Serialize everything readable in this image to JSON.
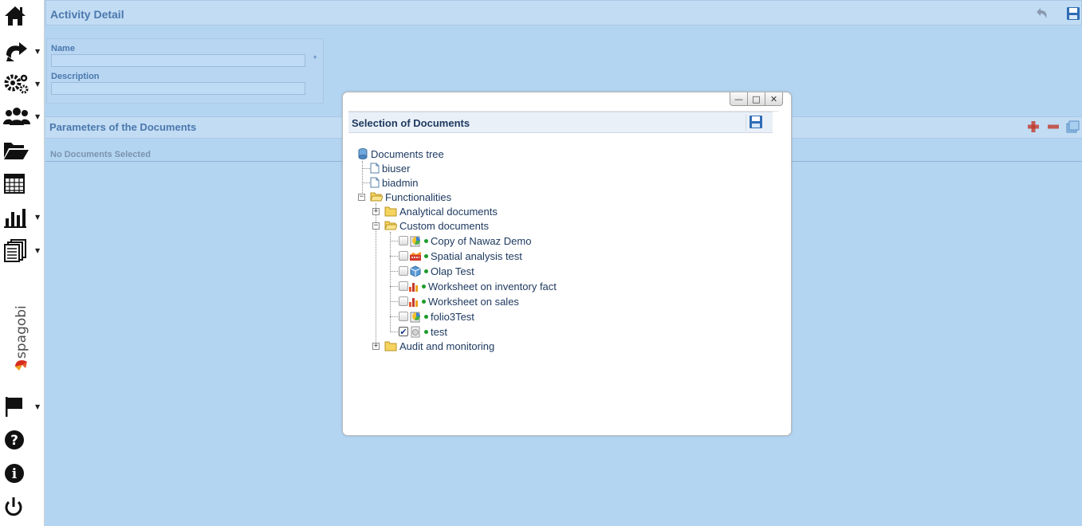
{
  "sidebar": {
    "logo_text": "spagobi",
    "items": [
      {
        "icon": "home-icon",
        "has_menu": false
      },
      {
        "icon": "roles-icon",
        "has_menu": true
      },
      {
        "icon": "gears-icon",
        "has_menu": true
      },
      {
        "icon": "users-icon",
        "has_menu": true
      },
      {
        "icon": "folder-icon",
        "has_menu": false
      },
      {
        "icon": "calendar-icon",
        "has_menu": false
      },
      {
        "icon": "bar-chart-icon",
        "has_menu": true
      },
      {
        "icon": "documents-icon",
        "has_menu": true
      },
      {
        "icon": "flag-icon",
        "has_menu": true
      },
      {
        "icon": "help-icon",
        "has_menu": false
      },
      {
        "icon": "info-icon",
        "has_menu": false
      },
      {
        "icon": "power-icon",
        "has_menu": false
      }
    ]
  },
  "header": {
    "title": "Activity Detail"
  },
  "form": {
    "name_label": "Name",
    "name_value": "",
    "required_mark": "*",
    "description_label": "Description",
    "description_value": ""
  },
  "parameters": {
    "title": "Parameters of the Documents",
    "empty_text": "No Documents Selected"
  },
  "dialog": {
    "title": "Selection of Documents",
    "buttons": {
      "minimize": "—",
      "maximize": "□",
      "close": "✕"
    },
    "tree": {
      "root": "Documents tree",
      "biuser": "biuser",
      "biadmin": "biadmin",
      "functionalities": "Functionalities",
      "analytical": "Analytical documents",
      "custom": "Custom documents",
      "audit": "Audit and monitoring",
      "documents": [
        {
          "label": "Copy of Nawaz Demo",
          "checked": false,
          "icon": "chart-doc-icon"
        },
        {
          "label": "Spatial analysis test",
          "checked": false,
          "icon": "map-doc-icon"
        },
        {
          "label": "Olap Test",
          "checked": false,
          "icon": "olap-doc-icon"
        },
        {
          "label": "Worksheet on inventory fact",
          "checked": false,
          "icon": "worksheet-doc-icon"
        },
        {
          "label": "Worksheet on sales",
          "checked": false,
          "icon": "worksheet-doc-icon"
        },
        {
          "label": "folio3Test",
          "checked": false,
          "icon": "chart-doc-icon"
        },
        {
          "label": "test",
          "checked": true,
          "icon": "generic-doc-icon"
        }
      ]
    }
  },
  "colors": {
    "background": "#b3d5f2",
    "header_text": "#4a78ad",
    "tree_text": "#1e3a60",
    "dialog_title": "#1e3a60"
  }
}
